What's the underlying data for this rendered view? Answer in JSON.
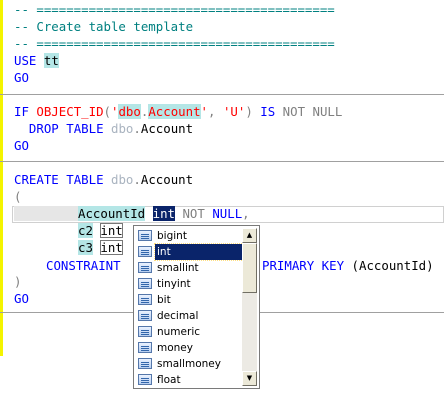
{
  "code": {
    "l1": "-- ========================================",
    "l2": "-- Create table template",
    "l3": "-- ========================================",
    "l4_use": "USE",
    "l4_db": "tt",
    "go": "GO",
    "if_kw": "IF",
    "object_id": "OBJECT_ID",
    "open_paren": "(",
    "quote": "'",
    "dbo": "dbo",
    "dot": ".",
    "account": "Account",
    "comma_space": ", ",
    "u_literal": "'U'",
    "close_paren": ")",
    "is_kw": "IS",
    "not_kw": "NOT",
    "null_kw": "NULL",
    "drop_kw": "DROP",
    "table_kw": "TABLE",
    "create_kw": "CREATE",
    "col1_name": "AccountId",
    "col_type_int": "int",
    "comma": ",",
    "col2_name": "c2",
    "col3_name": "c3",
    "constraint_kw": "CONSTRAINT",
    "primary_key_kw": "PRIMARY KEY",
    "pk_col": "(AccountId)"
  },
  "completion": {
    "items": [
      "bigint",
      "int",
      "smallint",
      "tinyint",
      "bit",
      "decimal",
      "numeric",
      "money",
      "smallmoney",
      "float"
    ],
    "selected_index": 1,
    "item_icon": "datatype-icon"
  },
  "colors": {
    "comment": "#008080",
    "keyword": "#0000ff",
    "string": "#ff0000",
    "selection": "#0a246a",
    "margin": "#f4f400"
  }
}
